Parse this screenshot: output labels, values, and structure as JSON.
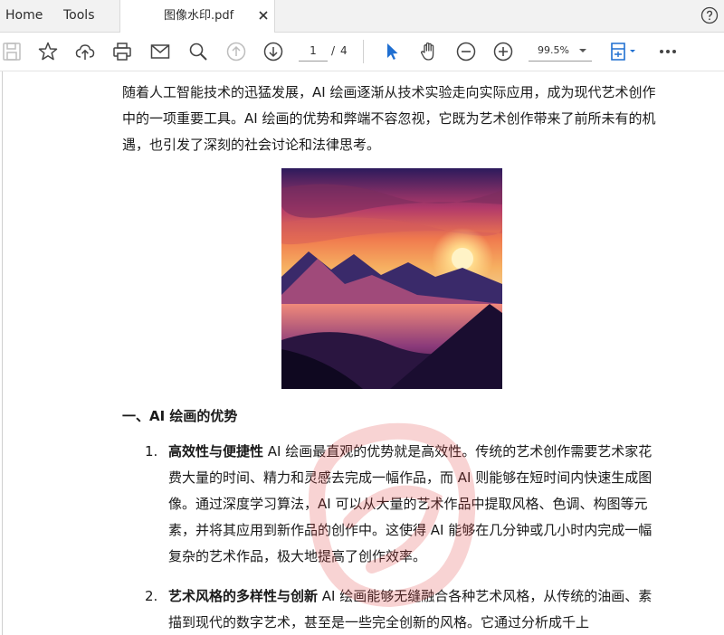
{
  "tabs": {
    "home": "Home",
    "tools": "Tools",
    "document": "图像水印.pdf"
  },
  "toolbar": {
    "current_page": "1",
    "page_separator": "/",
    "total_pages": "4",
    "zoom": "99.5%"
  },
  "icons": [
    "save-icon",
    "star-icon",
    "cloud-upload-icon",
    "print-icon",
    "mail-icon",
    "search-icon",
    "page-up-icon",
    "page-down-icon",
    "select-cursor-icon",
    "hand-icon",
    "zoom-out-icon",
    "zoom-in-icon",
    "fit-page-icon",
    "more-icon",
    "help-icon",
    "close-icon"
  ],
  "colors": {
    "accent": "#1f6fd1",
    "tabbar_bg": "#f2f2f2",
    "watermark": "#e23b3b"
  },
  "document": {
    "intro": "随着人工智能技术的迅猛发展，AI 绘画逐渐从技术实验走向实际应用，成为现代艺术创作中的一项重要工具。AI 绘画的优势和弊端不容忽视，它既为艺术创作带来了前所未有的机遇，也引发了深刻的社会讨论和法律思考。",
    "heading": "一、AI 绘画的优势",
    "items": [
      {
        "num": "1.",
        "title": "高效性与便捷性",
        "text": " AI 绘画最直观的优势就是高效性。传统的艺术创作需要艺术家花费大量的时间、精力和灵感去完成一幅作品，而 AI 则能够在短时间内快速生成图像。通过深度学习算法，AI 可以从大量的艺术作品中提取风格、色调、构图等元素，并将其应用到新作品的创作中。这使得 AI 能够在几分钟或几小时内完成一幅复杂的艺术作品，极大地提高了创作效率。"
      },
      {
        "num": "2.",
        "title": "艺术风格的多样性与创新",
        "text": " AI 绘画能够无缝融合各种艺术风格，从传统的油画、素描到现代的数字艺术，甚至是一些完全创新的风格。它通过分析成千上"
      }
    ]
  }
}
